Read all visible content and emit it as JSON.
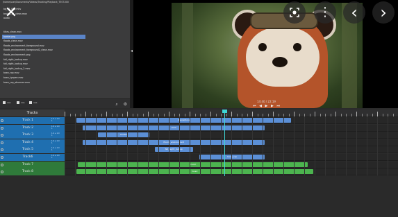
{
  "colors": {
    "selected_row": "#5a84c8",
    "blue_track_label": "#1f6fb0",
    "blue_clip": "#5b8fd6",
    "green_track_label": "#2f7a3a",
    "green_clip": "#4cb44f",
    "playhead": "#3fd6d6"
  },
  "file_panel": {
    "path": "/home/user/Documents/Videos/Tracking/Playback_TEST.000",
    "items": [
      {
        "label": "bg_01_001.mkv",
        "selected": false
      },
      {
        "label": "track1_01_clean.mov",
        "selected": false
      },
      {
        "label": "audio",
        "selected": false
      },
      {
        "label": "",
        "selected": false
      },
      {
        "label": "",
        "selected": false
      },
      {
        "label": "titles_clean.mov",
        "selected": false
      },
      {
        "label": "border.png",
        "selected": true
      },
      {
        "label": "floods_clean.mov",
        "selected": false
      },
      {
        "label": "floods_environment_foreground.mov",
        "selected": false
      },
      {
        "label": "floods_environment_foreground2_clean.mov",
        "selected": false
      },
      {
        "label": "floods_environment.png",
        "selected": false
      },
      {
        "label": "fall_night_lookup.mov",
        "selected": false
      },
      {
        "label": "fall_night_lookup.mov",
        "selected": false
      },
      {
        "label": "fall_night_lookup_2.mov",
        "selected": false
      },
      {
        "label": "town_rop.mov",
        "selected": false
      },
      {
        "label": "town_tyopee.mov",
        "selected": false
      },
      {
        "label": "town_rop_observer.mov",
        "selected": false
      }
    ],
    "bottom_labels": [
      "aaa",
      "aaa",
      "aaa"
    ],
    "bottom_icons": [
      "search-icon",
      "gear-icon"
    ]
  },
  "preview": {
    "time": "14:40 / 22:19",
    "transport": "⏮ ◀ ▶ ▶ ⏭",
    "overlay_icons": [
      "close-icon",
      "lens-icon",
      "more-icon",
      "chevron-left-icon",
      "chevron-right-icon"
    ],
    "close_glyph": "✕",
    "more_glyph": "⋮",
    "prev_glyph": "‹",
    "next_glyph": "›",
    "lens_glyph": "◉",
    "collapse_glyph": "◂"
  },
  "timeline": {
    "header": "Tracks",
    "tracks": [
      {
        "name": "Track 1",
        "meta": "1.0 ↔ 1.0\n1",
        "color": "blue",
        "clips": [
          {
            "label": "dispositions",
            "start": 0.035,
            "end": 0.68
          }
        ]
      },
      {
        "name": "Track 2",
        "meta": "1.0 ↔ 1.0\n1",
        "color": "blue",
        "clips": [
          {
            "label": "clock",
            "start": 0.055,
            "end": 0.6
          }
        ]
      },
      {
        "name": "Track 3",
        "meta": "1.0 ↔ 1.0\n1",
        "color": "blue",
        "clips": [
          {
            "label": "border",
            "start": 0.1,
            "end": 0.255
          }
        ]
      },
      {
        "name": "Track 4",
        "meta": "1.0 ↔ 1.0\n1",
        "color": "blue",
        "clips": [
          {
            "label": "floods_environment",
            "start": 0.055,
            "end": 0.6
          }
        ]
      },
      {
        "name": "Track 5",
        "meta": "1.0 ↔ 1.0\n1",
        "color": "blue",
        "clips": [
          {
            "label": "fall_night_lookup",
            "start": 0.27,
            "end": 0.385
          }
        ]
      },
      {
        "name": "Track6",
        "meta": "1.0 ↔ 1.0\n1",
        "color": "blue",
        "clips": [
          {
            "label": "town_rop",
            "start": 0.405,
            "end": 0.6
          }
        ]
      },
      {
        "name": "Track 7",
        "meta": "",
        "color": "green",
        "clips": [
          {
            "label": "music",
            "start": 0.04,
            "end": 0.73
          }
        ]
      },
      {
        "name": "Track 8",
        "meta": "",
        "color": "green",
        "clips": [
          {
            "label": "music",
            "start": 0.035,
            "end": 0.745
          }
        ]
      }
    ],
    "playhead_position": 0.48
  }
}
